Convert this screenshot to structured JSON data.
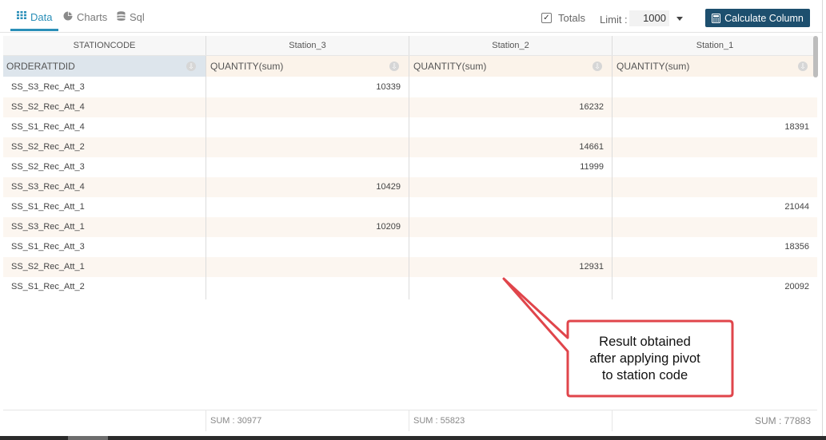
{
  "tabs": [
    {
      "label": "Data",
      "active": true,
      "icon": "grid-icon"
    },
    {
      "label": "Charts",
      "active": false,
      "icon": "pie-chart-icon"
    },
    {
      "label": "Sql",
      "active": false,
      "icon": "database-icon"
    }
  ],
  "toolbar": {
    "totals_label": "Totals",
    "totals_checked": true,
    "limit_label": "Limit :",
    "limit_value": "1000",
    "calculate_button": "Calculate Column"
  },
  "grid": {
    "pivot_header": "STATIONCODE",
    "row_header": "ORDERATTDID",
    "columns": [
      {
        "station": "Station_3",
        "measure": "QUANTITY(sum)"
      },
      {
        "station": "Station_2",
        "measure": "QUANTITY(sum)"
      },
      {
        "station": "Station_1",
        "measure": "QUANTITY(sum)"
      }
    ],
    "rows": [
      {
        "id": "SS_S3_Rec_Att_3",
        "values": [
          "10339",
          "",
          ""
        ]
      },
      {
        "id": "SS_S2_Rec_Att_4",
        "values": [
          "",
          "16232",
          ""
        ]
      },
      {
        "id": "SS_S1_Rec_Att_4",
        "values": [
          "",
          "",
          "18391"
        ]
      },
      {
        "id": "SS_S2_Rec_Att_2",
        "values": [
          "",
          "14661",
          ""
        ]
      },
      {
        "id": "SS_S2_Rec_Att_3",
        "values": [
          "",
          "11999",
          ""
        ]
      },
      {
        "id": "SS_S3_Rec_Att_4",
        "values": [
          "10429",
          "",
          ""
        ]
      },
      {
        "id": "SS_S1_Rec_Att_1",
        "values": [
          "",
          "",
          "21044"
        ]
      },
      {
        "id": "SS_S3_Rec_Att_1",
        "values": [
          "10209",
          "",
          ""
        ]
      },
      {
        "id": "SS_S1_Rec_Att_3",
        "values": [
          "",
          "",
          "18356"
        ]
      },
      {
        "id": "SS_S2_Rec_Att_1",
        "values": [
          "",
          "12931",
          ""
        ]
      },
      {
        "id": "SS_S1_Rec_Att_2",
        "values": [
          "",
          "",
          "20092"
        ]
      }
    ],
    "footer": [
      "SUM : 30977",
      "SUM : 55823",
      "SUM : 77883"
    ]
  },
  "callout": {
    "line1": "Result obtained",
    "line2": "after applying pivot",
    "line3": "to station code"
  },
  "colors": {
    "accent": "#2a8fb8",
    "button": "#1d4f6e",
    "callout_border": "#e0454b"
  }
}
